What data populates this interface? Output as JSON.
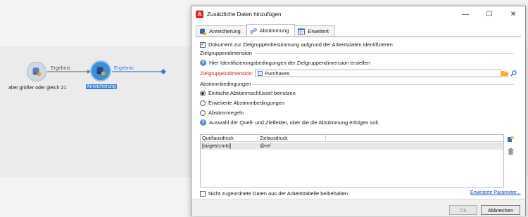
{
  "workflow": {
    "node1_label": "alter größer oder gleich 21",
    "node2_label": "Anreicherung",
    "edge1_label": "Ergebnis",
    "edge2_label": "Ergebnis"
  },
  "dialog": {
    "title": "Zusätzliche Daten hinzufügen",
    "app_icon_letter": "A",
    "window_buttons": {
      "minimize": "—",
      "maximize": "☐",
      "close": "✕"
    },
    "tabs": [
      {
        "label": "Anreicherung"
      },
      {
        "label": "Abstimmung"
      },
      {
        "label": "Erweitert"
      }
    ],
    "identify_checkbox": {
      "label": "Dokument zur Zielgruppenbestimmung aufgrund der Arbeitsdaten identifizieren",
      "checked": true
    },
    "targeting_group": {
      "title": "Zielgruppendimension",
      "info_text": "Hier Identifizierungsbedingungen der Zielgruppendimension erstellen",
      "field_label": "Zielgruppendimension:",
      "field_value": "Purchases"
    },
    "conditions_group": {
      "title": "Abstimmbedingungen",
      "options": [
        {
          "label": "Einfache Abstimmschlüssel benutzen",
          "selected": true
        },
        {
          "label": "Erweiterte Abstimmbedingungen",
          "selected": false
        },
        {
          "label": "Abstimmregeln",
          "selected": false
        }
      ],
      "info_text": "Auswahl der Quell- und Zielfelder, über die die Abstimmung erfolgen soll."
    },
    "grid": {
      "columns": [
        "Quellausdruck",
        "Zielausdruck"
      ],
      "rows": [
        [
          "[target/crmId]",
          "@ref"
        ]
      ]
    },
    "keep_unassigned_checkbox": {
      "label": "Nicht zugeordnete Daten aus der Arbeitstabelle beibehalten",
      "checked": false
    },
    "advanced_params_link": "Erweiterte Parameter...",
    "footer": {
      "ok_label": "OK",
      "cancel_label": "Abbrechen"
    },
    "colors": {
      "accent_blue": "#3a7fcf",
      "required_red": "#d02020",
      "app_red": "#e0281e"
    }
  }
}
